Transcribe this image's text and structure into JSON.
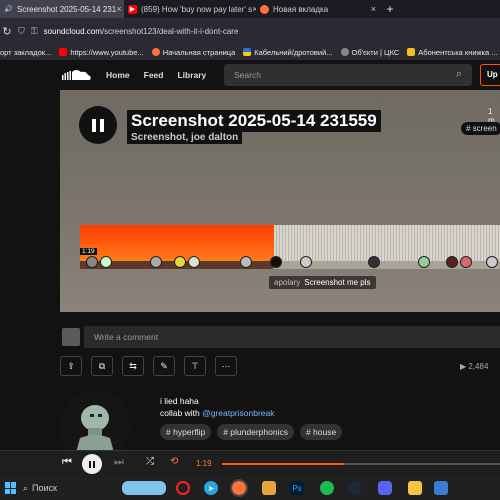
{
  "browser": {
    "tabs": [
      {
        "label": "Screenshot 2025-05-14 231",
        "active": true
      },
      {
        "label": "(859) How 'buy now pay later' s",
        "active": false
      },
      {
        "label": "Новая вкладка",
        "active": false
      }
    ],
    "url_host": "soundcloud.com",
    "url_path": "/screenshot123/deal-with-it-i-dont-care",
    "bookmarks": [
      "орт закладок...",
      "https://www.youtube...",
      "Начальная страница",
      "Кабельний/дротовий...",
      "Об'єкти | ЦКС",
      "Абонентська книжка ..."
    ]
  },
  "header": {
    "nav": [
      "Home",
      "Feed",
      "Library"
    ],
    "search_placeholder": "Search",
    "upload_label": "Up"
  },
  "track": {
    "title": "Screenshot 2025-05-14 231559",
    "artist": "Screenshot, joe dalton",
    "date": "1 m",
    "tag": "# screen",
    "current_time": "1:19",
    "progress": 0.44,
    "comment_user": "apolary",
    "comment_text": "Screenshot me pls"
  },
  "comment_input_placeholder": "Write a comment",
  "actions": [
    "share",
    "copy",
    "repost",
    "edit",
    "add-to-next",
    "more"
  ],
  "plays_count": "2,484",
  "description": {
    "line1": "i lied haha",
    "line2_prefix": "collab with ",
    "mention": "@greatprisonbreak",
    "tags": [
      "# hyperflip",
      "# plunderphonics",
      "# house"
    ]
  },
  "player": {
    "time": "1:19",
    "progress": 0.44
  },
  "taskbar": {
    "search_label": "Поиск"
  },
  "colors": {
    "accent": "#ff5500",
    "background": "#121212"
  }
}
